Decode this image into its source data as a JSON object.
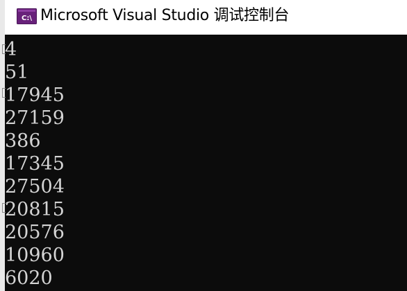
{
  "window": {
    "title": "Microsoft Visual Studio 调试控制台",
    "icon": "cmd-terminal-icon",
    "icon_colors": {
      "background": "#68217a",
      "foreground": "#ffffff"
    }
  },
  "console": {
    "background": "#0c0c0c",
    "text_color": "#d4d4d4",
    "lines": [
      "4",
      "51",
      "17945",
      "27159",
      "386",
      "17345",
      "27504",
      "20815",
      "20576",
      "10960",
      "6020"
    ]
  }
}
